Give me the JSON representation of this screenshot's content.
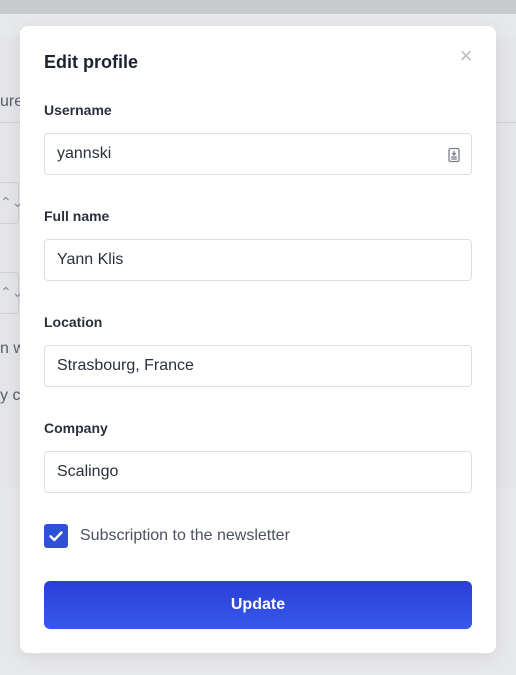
{
  "background": {
    "snippet_1": "ure",
    "snippet_2": "n w",
    "snippet_3": "y c",
    "chevron_glyph": "⌃⌄"
  },
  "modal": {
    "title": "Edit profile",
    "close_glyph": "×",
    "fields": {
      "username": {
        "label": "Username",
        "value": "yannski"
      },
      "full_name": {
        "label": "Full name",
        "value": "Yann Klis"
      },
      "location": {
        "label": "Location",
        "value": "Strasbourg, France"
      },
      "company": {
        "label": "Company",
        "value": "Scalingo"
      }
    },
    "newsletter": {
      "label": "Subscription to the newsletter",
      "checked": true
    },
    "submit_label": "Update"
  },
  "colors": {
    "accent": "#2f51d8",
    "button_gradient_top": "#2a3fd8",
    "button_gradient_bottom": "#3658ea"
  }
}
